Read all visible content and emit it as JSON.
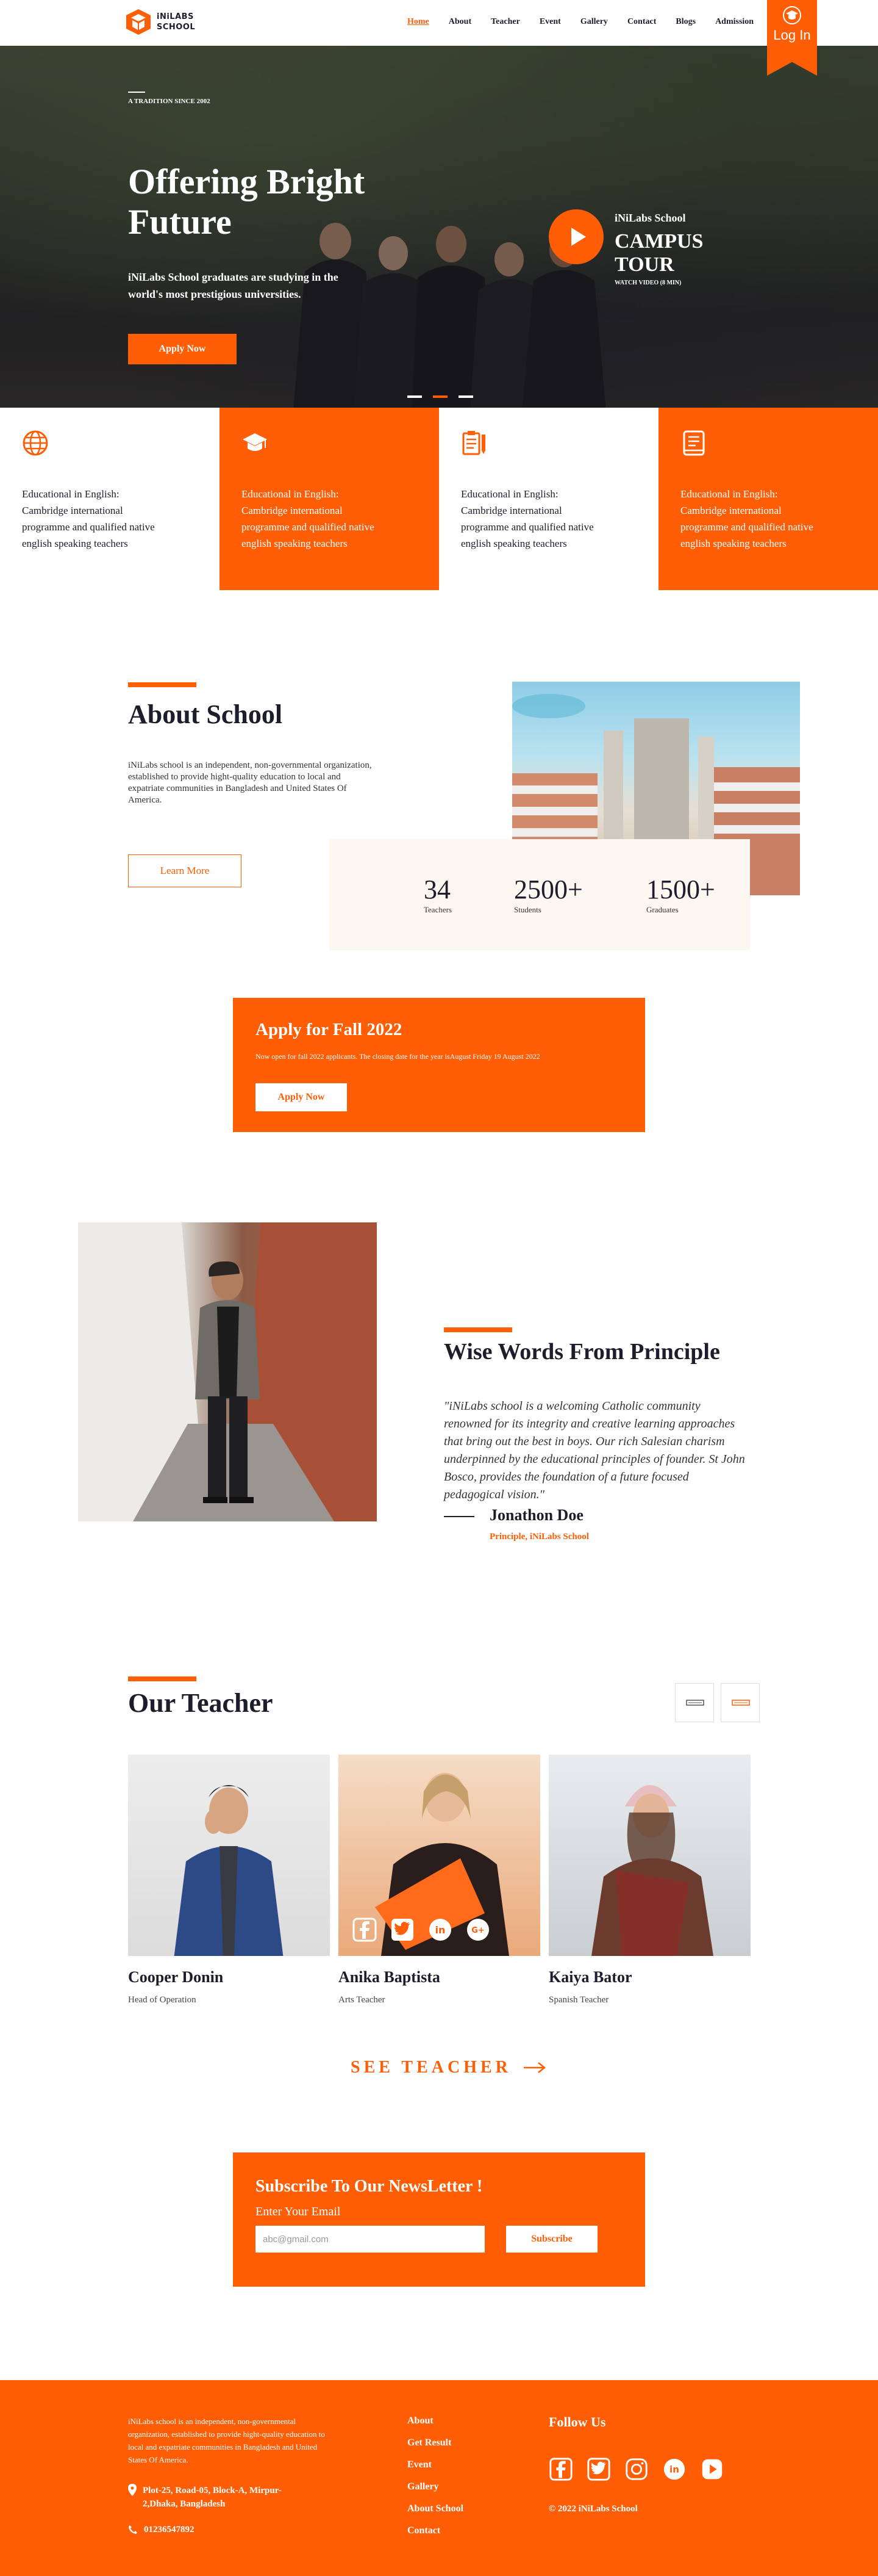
{
  "brand": {
    "name_line1": "iNiLABS",
    "name_line2": "SCHOOL"
  },
  "nav": [
    {
      "label": "Home",
      "active": true
    },
    {
      "label": "About"
    },
    {
      "label": "Teacher"
    },
    {
      "label": "Event"
    },
    {
      "label": "Gallery"
    },
    {
      "label": "Contact"
    },
    {
      "label": "Blogs"
    },
    {
      "label": "Admission"
    }
  ],
  "login": {
    "label": "Log In"
  },
  "hero": {
    "tag": "A TRADITION SINCE 2002",
    "title_line1": "Offering Bright",
    "title_line2": "Future",
    "subtitle": "iNiLabs School graduates are studying in the world's most prestigious universities.",
    "apply_label": "Apply Now",
    "campus_small": "iNiLabs School",
    "campus_big_1": "CAMPUS",
    "campus_big_2": "TOUR",
    "watch": "WATCH VIDEO (8 MIN)",
    "slides": 3,
    "active_slide": 2
  },
  "features": [
    {
      "icon": "globe-icon",
      "text": "Educational in English: Cambridge international programme and qualified native english speaking teachers"
    },
    {
      "icon": "graduation-cap-icon",
      "text": "Educational in English: Cambridge international programme and qualified native english speaking teachers"
    },
    {
      "icon": "clipboard-pencil-icon",
      "text": "Educational in English: Cambridge international programme and qualified native english speaking teachers"
    },
    {
      "icon": "notebook-icon",
      "text": "Educational in English: Cambridge international programme and qualified native english speaking teachers"
    }
  ],
  "about": {
    "title": "About School",
    "text": "iNiLabs school is an independent, non-governmental organization, established to provide hight-quality education to local and expatriate communities in Bangladesh and United States Of America.",
    "learn_more": "Learn More",
    "stats": [
      {
        "value": "34",
        "label": "Teachers"
      },
      {
        "value": "2500+",
        "label": "Students"
      },
      {
        "value": "1500+",
        "label": "Graduates"
      }
    ]
  },
  "apply": {
    "title": "Apply for Fall 2022",
    "subtitle": "Now open for fall 2022 applicants. The closing date for the year isAugust Friday 19 August 2022",
    "button": "Apply Now"
  },
  "principle": {
    "title": "Wise Words From Principle",
    "quote": "\"iNiLabs school is a welcoming Catholic community renowned for its integrity and creative learning approaches that bring out the best in boys. Our rich Salesian charism underpinned by the educational principles of founder. St John Bosco, provides the foundation of a future focused pedagogical vision.\"",
    "name": "Jonathon Doe",
    "role": "Principle, iNiLabs School"
  },
  "teachers": {
    "title": "Our Teacher",
    "items": [
      {
        "name": "Cooper Donin",
        "role": "Head of Operation"
      },
      {
        "name": "Anika Baptista",
        "role": "Arts Teacher"
      },
      {
        "name": "Kaiya Bator",
        "role": "Spanish Teacher"
      }
    ],
    "see_all": "SEE TEACHER"
  },
  "newsletter": {
    "title": "Subscribe To Our NewsLetter !",
    "label": "Enter Your Email",
    "placeholder": "abc@gmail.com",
    "button": "Subscribe"
  },
  "footer": {
    "about": "iNiLabs school is an independent, non-governmental organization, established to provide hight-quality education to local and expatriate communities in Bangladesh and United States Of America.",
    "address_1": "Plot-25, Road-05, Block-A, Mirpur-",
    "address_2": "2,Dhaka, Bangladesh",
    "phone": "01236547892",
    "links": [
      "About",
      "Get Result",
      "Event",
      "Gallery",
      "About School",
      "Contact"
    ],
    "follow": "Follow Us",
    "copyright": "© 2022 iNiLabs School"
  },
  "colors": {
    "accent": "#FF5E07",
    "dark": "#1D1D2C",
    "cream": "#FDF7F2"
  }
}
